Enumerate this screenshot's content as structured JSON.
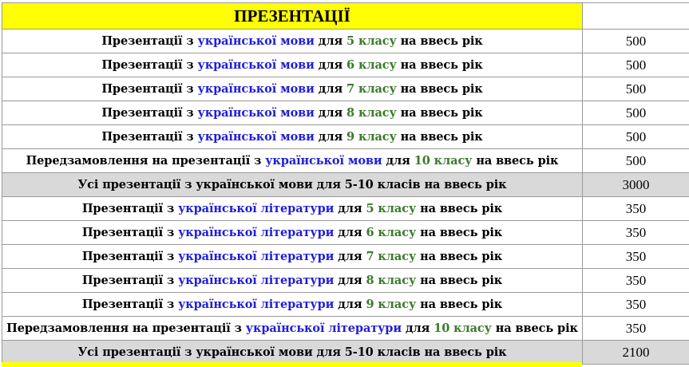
{
  "header": {
    "title": "ПРЕЗЕНТАЦІЇ",
    "price_header": ""
  },
  "colors": {
    "header_bg": "#ffff00",
    "subject_text": "#1f1fd6",
    "grade_text": "#3a7a2a",
    "total_row_bg": "#d9d9d9"
  },
  "rows": [
    {
      "prefix": "Презентації з ",
      "subject": "української мови",
      "mid": " для ",
      "grade": "5 класу",
      "suffix": " на ввесь рік",
      "price": "500",
      "total": false
    },
    {
      "prefix": "Презентації з ",
      "subject": "української мови",
      "mid": " для ",
      "grade": "6 класу",
      "suffix": " на ввесь рік",
      "price": "500",
      "total": false
    },
    {
      "prefix": "Презентації з ",
      "subject": "української мови",
      "mid": " для ",
      "grade": "7 класу",
      "suffix": " на ввесь рік",
      "price": "500",
      "total": false
    },
    {
      "prefix": "Презентації з ",
      "subject": "української мови",
      "mid": " для ",
      "grade": "8 класу",
      "suffix": " на ввесь рік",
      "price": "500",
      "total": false
    },
    {
      "prefix": "Презентації з ",
      "subject": "української мови",
      "mid": " для ",
      "grade": "9 класу",
      "suffix": " на ввесь рік",
      "price": "500",
      "total": false
    },
    {
      "prefix": "Передзамовлення на презентації з ",
      "subject": "української мови",
      "mid": " для ",
      "grade": "10 класу",
      "suffix": " на ввесь рік",
      "price": "500",
      "total": false
    },
    {
      "prefix": "Усі презентації з української мови для 5-10 класів на ввесь рік",
      "subject": "",
      "mid": "",
      "grade": "",
      "suffix": "",
      "price": "3000",
      "total": true
    },
    {
      "prefix": "Презентації з ",
      "subject": "української літератури",
      "mid": " для ",
      "grade": "5 класу",
      "suffix": " на ввесь рік",
      "price": "350",
      "total": false
    },
    {
      "prefix": "Презентації з ",
      "subject": "української літератури",
      "mid": " для ",
      "grade": "6 класу",
      "suffix": " на ввесь рік",
      "price": "350",
      "total": false
    },
    {
      "prefix": "Презентації з ",
      "subject": "української літератури",
      "mid": " для ",
      "grade": "7 класу",
      "suffix": " на ввесь рік",
      "price": "350",
      "total": false
    },
    {
      "prefix": "Презентації з ",
      "subject": "української літератури",
      "mid": " для ",
      "grade": "8 класу",
      "suffix": " на ввесь рік",
      "price": "350",
      "total": false
    },
    {
      "prefix": "Презентації з ",
      "subject": "української літератури",
      "mid": " для ",
      "grade": "9 класу",
      "suffix": " на ввесь рік",
      "price": "350",
      "total": false
    },
    {
      "prefix": "Передзамовлення на презентації з ",
      "subject": "української літератури",
      "mid": " для ",
      "grade": "10 класу",
      "suffix": " на ввесь рік",
      "price": "350",
      "total": false
    },
    {
      "prefix": "Усі презентації з української мови для 5-10 класів на ввесь рік",
      "subject": "",
      "mid": "",
      "grade": "",
      "suffix": "",
      "price": "2100",
      "total": true
    }
  ]
}
